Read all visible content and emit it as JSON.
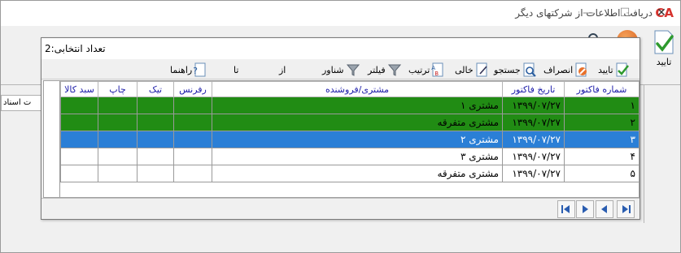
{
  "window": {
    "title": "دریافت اطلاعات از شرکتهای دیگر",
    "app_icon_text": "CA",
    "minimize_glyph": "—",
    "maximize_glyph": "☐",
    "close_glyph": "✕"
  },
  "outer_toolbar": {
    "confirm_label": "تایید",
    "partial_tab_label": "ت اسناد"
  },
  "dialog": {
    "title": "تعداد انتخابی:2",
    "toolbar": [
      {
        "label": "تایید",
        "icon": "check-icon"
      },
      {
        "label": "انصراف",
        "icon": "cancel-icon"
      },
      {
        "label": "جستجو",
        "icon": "search-icon"
      },
      {
        "label": "خالی",
        "icon": "clear-icon"
      },
      {
        "label": "ترتیب",
        "icon": "sort-icon"
      },
      {
        "label": "فیلتر",
        "icon": "filter-icon"
      },
      {
        "label": "شناور",
        "icon": "float-filter-icon"
      },
      {
        "label": "از",
        "icon": ""
      },
      {
        "label": "تا",
        "icon": ""
      },
      {
        "label": "راهنما",
        "icon": "help-icon"
      }
    ],
    "grid": {
      "columns": [
        "شماره فاکتور",
        "تاریخ فاکتور",
        "مشتری/فروشنده",
        "رفرنس",
        "تیک",
        "چاپ",
        "سبد کالا"
      ],
      "rows": [
        {
          "no": "۱",
          "date": "۱۳۹۹/۰۷/۲۷",
          "party": "مشتری ۱",
          "ref": "",
          "tick": "",
          "print": "",
          "basket": "",
          "state": "checked"
        },
        {
          "no": "۲",
          "date": "۱۳۹۹/۰۷/۲۷",
          "party": "مشتری متفرقه",
          "ref": "",
          "tick": "",
          "print": "",
          "basket": "",
          "state": "checked"
        },
        {
          "no": "۳",
          "date": "۱۳۹۹/۰۷/۲۷",
          "party": "مشتری ۲",
          "ref": "",
          "tick": "",
          "print": "",
          "basket": "",
          "state": "selected"
        },
        {
          "no": "۴",
          "date": "۱۳۹۹/۰۷/۲۷",
          "party": "مشتری ۳",
          "ref": "",
          "tick": "",
          "print": "",
          "basket": "",
          "state": "normal"
        },
        {
          "no": "۵",
          "date": "۱۳۹۹/۰۷/۲۷",
          "party": "مشتری متفرقه",
          "ref": "",
          "tick": "",
          "print": "",
          "basket": "",
          "state": "normal"
        }
      ]
    }
  },
  "colors": {
    "checked_row": "#218c14",
    "selected_row": "#2b7fd6",
    "header_text": "#1a1aa8",
    "app_icon": "#d6332e"
  }
}
